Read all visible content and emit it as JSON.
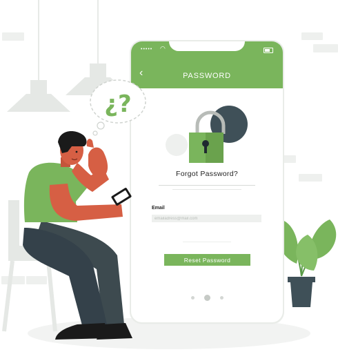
{
  "phone": {
    "title": "PASSWORD",
    "back_icon": "chevron-left-icon",
    "status_dots": "•••••",
    "heading": "Forgot Password?",
    "email_label": "Email",
    "email_placeholder": "emailadress@mail.com",
    "reset_label": "Reset Password",
    "pager_count": 3,
    "pager_active": 1
  },
  "illustration": {
    "thought_text": "¿?",
    "icons": [
      "padlock-icon",
      "thought-bubble-icon",
      "smartphone-icon",
      "plant-icon",
      "pendant-lamp-icon",
      "chair-icon"
    ]
  },
  "colors": {
    "accent": "#7ab55c",
    "dark_accent": "#3f5058",
    "skin": "#d65f44",
    "hair": "#1a1a1a",
    "pants": "#3d4a4f"
  }
}
